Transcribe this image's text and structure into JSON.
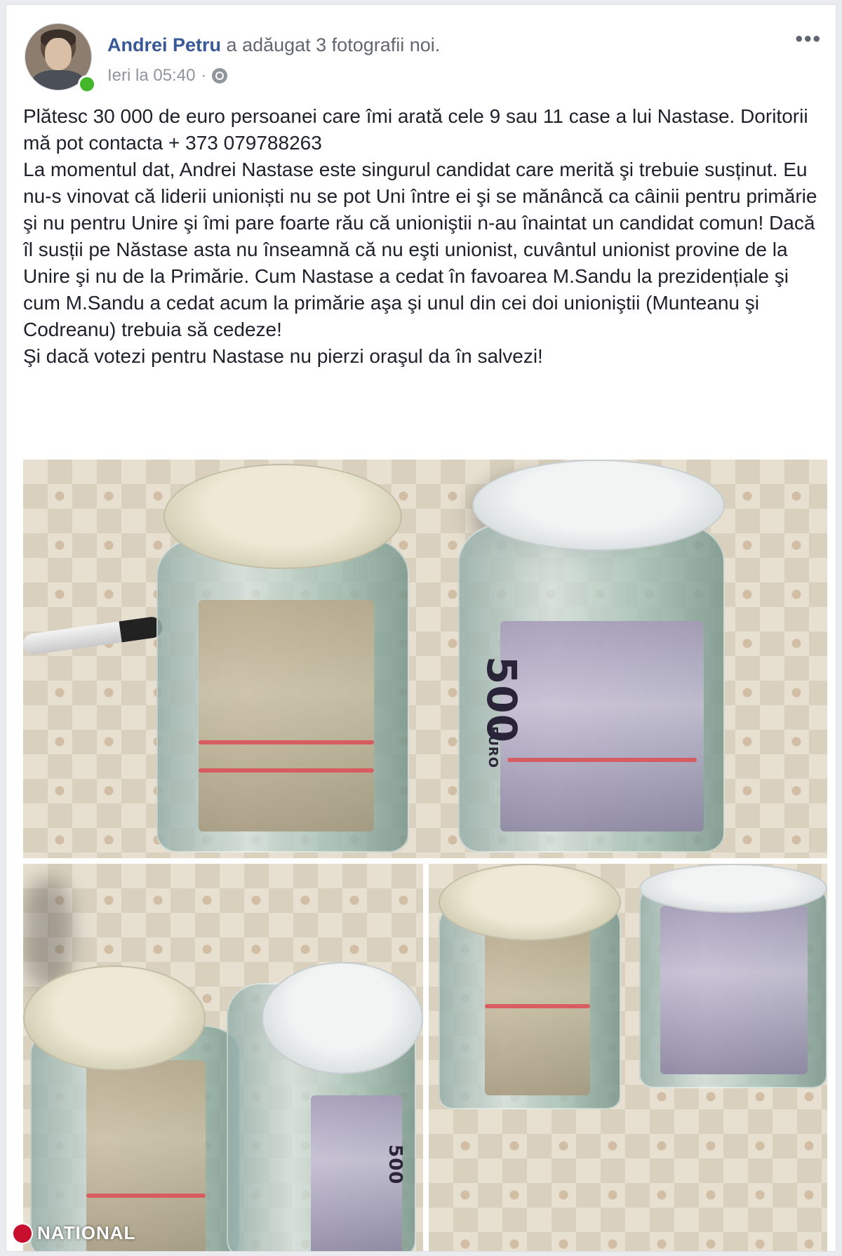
{
  "post": {
    "author": "Andrei Petru",
    "action": "a adăugat 3 fotografii noi.",
    "timestamp": "Ieri la 05:40",
    "separator": "·",
    "more_icon": "more-options-icon",
    "privacy_icon": "globe-icon",
    "text": {
      "line1": "Plătesc 30 000 de euro persoanei care îmi arată cele 9 sau 11 case a lui Nastase. Doritorii mă pot contacta + 373 079788263",
      "line2": "La momentul dat, Andrei Nastase este singurul candidat care merită şi trebuie susținut. Eu nu-s vinovat că liderii unioniști nu se pot Uni între ei şi se mănâncă ca câinii pentru primărie şi nu pentru Unire şi îmi pare foarte rău că unioniştii n-au înaintat un candidat comun! Dacă îl susții pe Năstase asta nu înseamnă că nu eşti unionist, cuvântul unionist provine de la Unire şi nu de la Primărie. Cum Nastase a cedat în favoarea M.Sandu la prezidențiale şi cum M.Sandu a cedat acum la primărie aşa şi unul din cei doi unioniştii (Munteanu şi Codreanu) trebuia să cedeze!",
      "line3": "Şi dacă votezi pentru Nastase nu pierzi oraşul da în salvezi!"
    },
    "photos": {
      "main_note_label": "500",
      "main_note_currency": "EURO",
      "left_note_label": "500"
    },
    "watermark": "NATIONAL",
    "online_color": "#42b72a",
    "name_color": "#385898"
  }
}
